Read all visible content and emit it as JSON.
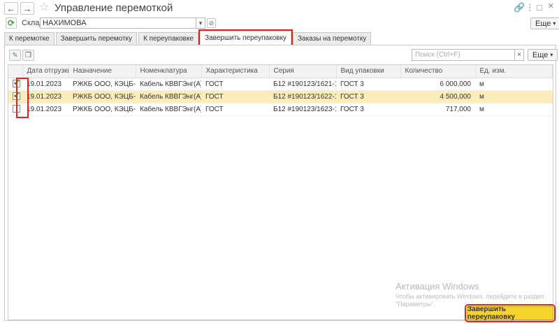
{
  "window": {
    "title": "Управление перемоткой",
    "back_icon": "←",
    "forward_icon": "→",
    "star_icon": "☆",
    "link_icon": "🔗",
    "menu_icon": "⋮",
    "maximize_icon": "□",
    "close_icon": "×"
  },
  "filter": {
    "label": "Склад:",
    "warehouse": "НАХИМОВА",
    "more_label": "Еще"
  },
  "tabs": [
    {
      "label": "К перемотке"
    },
    {
      "label": "Завершить перемотку"
    },
    {
      "label": "К переупаковке"
    },
    {
      "label": "Завершить переупаковку"
    },
    {
      "label": "Заказы на перемотку"
    }
  ],
  "panel": {
    "search_placeholder": "Поиск (Ctrl+F)",
    "search_clear": "×",
    "more_label": "Еще"
  },
  "table": {
    "columns": [
      "Дата отгрузки",
      "Назначение",
      "Номенклатура",
      "Характеристика",
      "Серия",
      "Вид упаковки",
      "Количество",
      "Ед. изм."
    ],
    "rows": [
      {
        "checked": true,
        "date": "19.01.2023",
        "purpose": "РЖКБ ООО, КЭЦБ-...",
        "item": "Кабель КВВГЭнг(А)-...",
        "char": "ГОСТ",
        "series": "Б12 #190123/1621-1...",
        "pack": "ГОСТ 3",
        "qty": "6 000,000",
        "unit": "м"
      },
      {
        "checked": true,
        "date": "19.01.2023",
        "purpose": "РЖКБ ООО, КЭЦБ-...",
        "item": "Кабель КВВГЭнг(А)-...",
        "char": "ГОСТ",
        "series": "Б12 #190123/1622-1...",
        "pack": "ГОСТ 3",
        "qty": "4 500,000",
        "unit": "м"
      },
      {
        "checked": false,
        "date": "19.01.2023",
        "purpose": "РЖКБ ООО, КЭЦБ-...",
        "item": "Кабель КВВГЭнг(А)-...",
        "char": "ГОСТ",
        "series": "Б12 #190123/1623-1...",
        "pack": "ГОСТ 3",
        "qty": "717,000",
        "unit": "м"
      }
    ]
  },
  "watermark": {
    "title": "Активация Windows",
    "text": "Чтобы активировать Windows, перейдите в раздел \"Параметры\"."
  },
  "actions": {
    "finish_label": "Завершить переупаковку"
  }
}
